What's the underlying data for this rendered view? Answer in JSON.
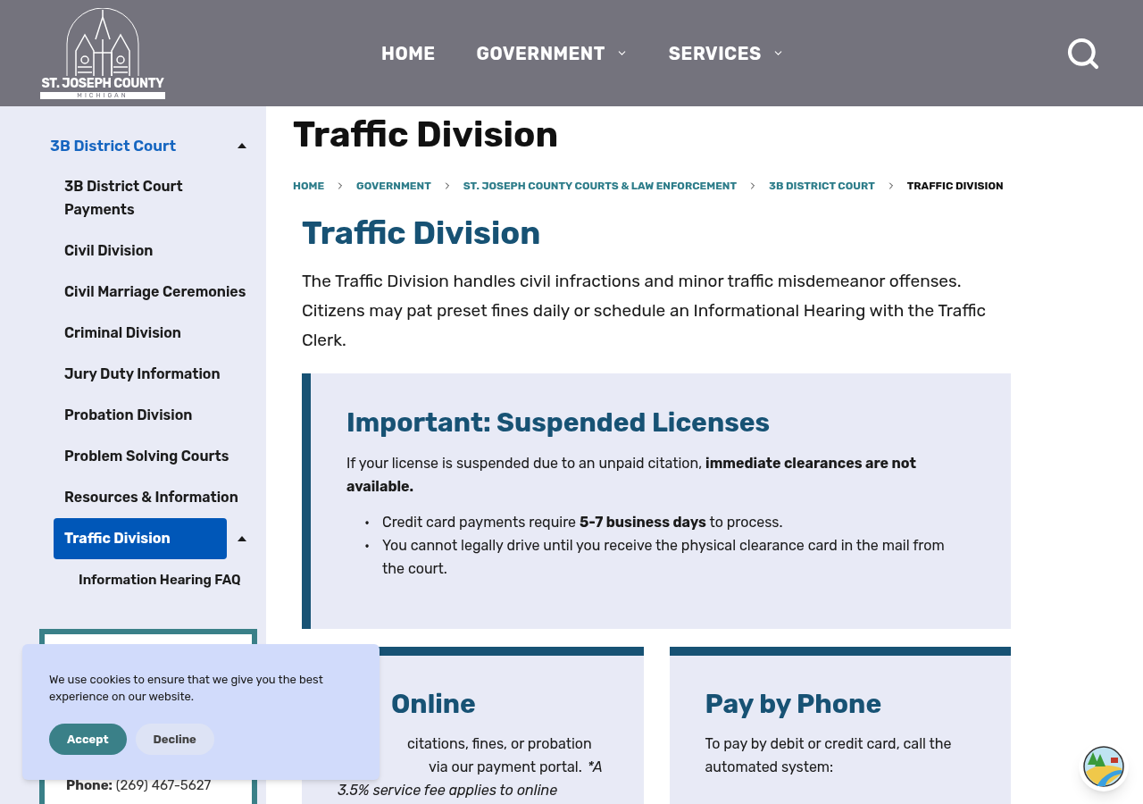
{
  "header": {
    "logo": {
      "name": "ST. JOSEPH COUNTY",
      "state": "MICHIGAN"
    },
    "nav": [
      {
        "label": "HOME",
        "dropdown": false
      },
      {
        "label": "GOVERNMENT",
        "dropdown": true
      },
      {
        "label": "SERVICES",
        "dropdown": true
      }
    ]
  },
  "sidebar": {
    "items": [
      {
        "label": "3B District Court",
        "selected": false,
        "expanded": true,
        "children": [
          {
            "label": "3B District Court Payments",
            "selected": false
          },
          {
            "label": "Civil Division",
            "selected": false
          },
          {
            "label": "Civil Marriage Ceremonies",
            "selected": false
          },
          {
            "label": "Criminal Division",
            "selected": false
          },
          {
            "label": "Jury Duty Information",
            "selected": false
          },
          {
            "label": "Probation Division",
            "selected": false
          },
          {
            "label": "Problem Solving Courts",
            "selected": false
          },
          {
            "label": "Resources & Information",
            "selected": false
          },
          {
            "label": "Traffic Division",
            "selected": true,
            "expanded": true,
            "children": [
              {
                "label": "Information Hearing FAQ",
                "selected": false
              }
            ]
          }
        ]
      }
    ],
    "contact": {
      "phone_label": "Phone:",
      "phone": "(269) 467-5627"
    }
  },
  "page_title": "Traffic Division",
  "breadcrumb": [
    {
      "label": "HOME",
      "current": false
    },
    {
      "label": "GOVERNMENT",
      "current": false
    },
    {
      "label": "ST. JOSEPH COUNTY COURTS & LAW ENFORCEMENT",
      "current": false
    },
    {
      "label": "3B DISTRICT COURT",
      "current": false
    },
    {
      "label": "TRAFFIC DIVISION",
      "current": true
    }
  ],
  "content": {
    "heading": "Traffic Division",
    "intro": "The Traffic Division handles civil infractions and minor traffic misdemeanor offenses. Citizens may pat preset fines daily or schedule an Informational Hearing with the Traffic Clerk.",
    "callout": {
      "heading": "Important: Suspended Licenses",
      "text": "If your license is suspended due to an unpaid citation, **immediate clearances are not available.**",
      "bullets": [
        {
          "marker": "•",
          "text": "Credit card payments require **5-7 business days** to process."
        },
        {
          "marker": "•",
          "text": "You cannot legally drive until you receive the physical clearance card in the mail from the court."
        }
      ]
    },
    "cards": [
      {
        "heading": "Online",
        "lines": [
          "citations, fines, or probation",
          "via our payment portal."
        ],
        "note": "*A",
        "note_cont": "3.5% service fee applies to online"
      },
      {
        "heading": "Pay by Phone",
        "lines": [
          "To pay by debit or credit card, call the automated system:"
        ]
      }
    ]
  },
  "cookie_banner": {
    "text": "We use cookies to ensure that we give you the best experience on our website.",
    "buttons": [
      {
        "label": "Accept",
        "primary": true
      },
      {
        "label": "Decline",
        "primary": false
      }
    ]
  }
}
